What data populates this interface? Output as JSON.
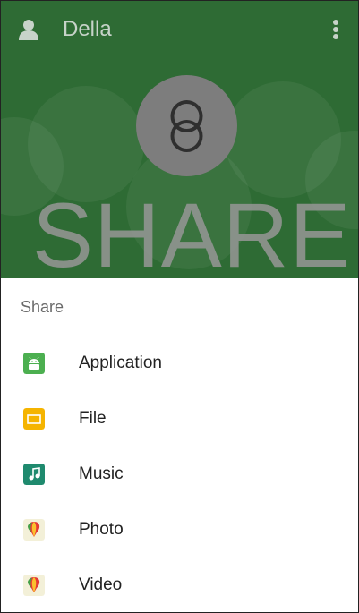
{
  "header": {
    "title": "Della"
  },
  "hero": {
    "banner_text": "SHARE"
  },
  "section": {
    "label": "Share"
  },
  "items": [
    {
      "label": "Application",
      "icon": "android-app-icon",
      "color": "#4caf50"
    },
    {
      "label": "File",
      "icon": "folder-icon",
      "color": "#f5b400"
    },
    {
      "label": "Music",
      "icon": "music-note-icon",
      "color": "#1f8a6e"
    },
    {
      "label": "Photo",
      "icon": "photo-balloon-icon",
      "color": "#e53935"
    },
    {
      "label": "Video",
      "icon": "video-balloon-icon",
      "color": "#e53935"
    }
  ],
  "colors": {
    "hero_bg": "#2e6b34"
  }
}
